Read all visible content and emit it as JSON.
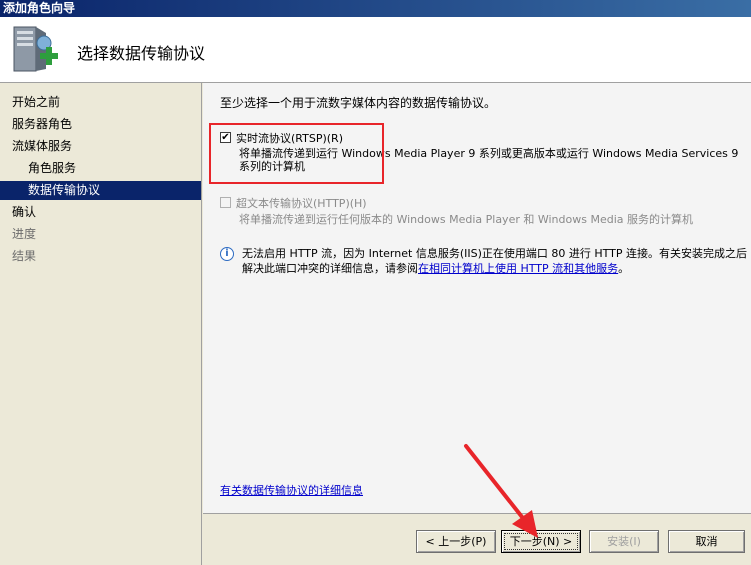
{
  "window": {
    "title": "添加角色向导"
  },
  "header": {
    "title": "选择数据传输协议",
    "icon": "server-add-icon"
  },
  "sidebar": {
    "items": [
      {
        "label": "开始之前"
      },
      {
        "label": "服务器角色"
      },
      {
        "label": "流媒体服务"
      },
      {
        "label": "角色服务"
      },
      {
        "label": "数据传输协议"
      },
      {
        "label": "确认"
      },
      {
        "label": "进度"
      },
      {
        "label": "结果"
      }
    ],
    "active_index": 4
  },
  "main": {
    "intro": "至少选择一个用于流数字媒体内容的数据传输协议。",
    "options": [
      {
        "label": "实时流协议(RTSP)(R)",
        "description": "将单播流传递到运行 Windows Media Player 9 系列或更高版本或运行 Windows Media Services 9 系列的计算机",
        "checked": true,
        "enabled": true
      },
      {
        "label": "超文本传输协议(HTTP)(H)",
        "description": "将单播流传递到运行任何版本的 Windows Media Player 和 Windows Media 服务的计算机",
        "checked": false,
        "enabled": false
      }
    ],
    "info": {
      "text": "无法启用 HTTP 流，因为 Internet 信息服务(IIS)正在使用端口 80 进行 HTTP 连接。有关安装完成之后解决此端口冲突的详细信息，请参阅",
      "link": "在相同计算机上使用 HTTP 流和其他服务",
      "suffix": "。"
    },
    "details_link": "有关数据传输协议的详细信息"
  },
  "buttons": {
    "back": "< 上一步(P)",
    "next": "下一步(N) >",
    "install": "安装(I)",
    "cancel": "取消"
  },
  "colors": {
    "highlight_box": "#e8252a",
    "arrow": "#e8252a",
    "active_nav": "#0a246a",
    "link": "#0000cc"
  }
}
